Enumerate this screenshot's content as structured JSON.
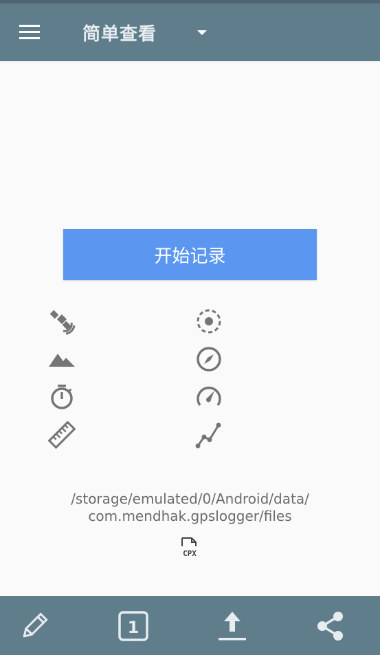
{
  "toolbar": {
    "title": "简单查看",
    "menu_icon": "hamburger-menu-icon",
    "dropdown_icon": "caret-down-icon"
  },
  "main": {
    "start_button_label": "开始记录",
    "detail_icons": [
      "satellite-icon",
      "accuracy-target-icon",
      "altitude-mountain-icon",
      "direction-compass-icon",
      "duration-stopwatch-icon",
      "speedometer-icon",
      "distance-ruler-icon",
      "track-points-icon"
    ],
    "storage_path_line1": "/storage/emulated/0/Android/data/",
    "storage_path_line2": "com.mendhak.gpslogger/files",
    "file_format_icon": "cpx-file-icon",
    "file_format_label": "CPX"
  },
  "bottom_bar": {
    "items": [
      "edit-pencil-icon",
      "one-point-icon",
      "upload-icon",
      "share-icon"
    ],
    "one_point_label": "1"
  },
  "colors": {
    "toolbar": "#607d8b",
    "accent_button": "#5b97f0",
    "icon_gray": "#757575",
    "background": "#fafafa"
  }
}
